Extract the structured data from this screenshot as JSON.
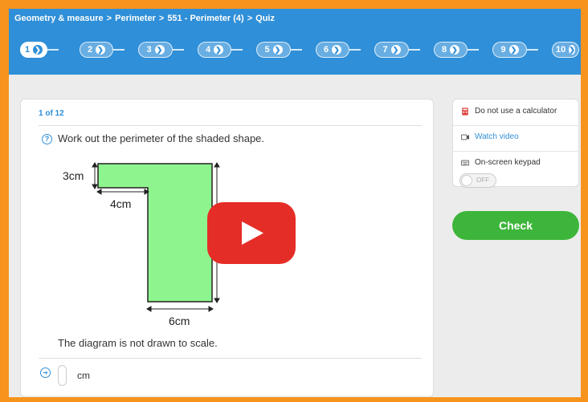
{
  "breadcrumb": [
    "Geometry & measure",
    "Perimeter",
    "551 - Perimeter (4)",
    "Quiz"
  ],
  "breadcrumb_sep": ">",
  "steps": [
    "1",
    "2",
    "3",
    "4",
    "5",
    "6",
    "7",
    "8",
    "9",
    "10"
  ],
  "active_step": "1",
  "question": {
    "counter": "1 of 12",
    "text": "Work out the perimeter of the shaded shape.",
    "labels": {
      "top_height": "3cm",
      "inner_width": "4cm",
      "bottom_width": "6cm"
    },
    "scale_note": "The diagram is not drawn to scale.",
    "answer_unit": "cm",
    "answer_value": ""
  },
  "sidebar": {
    "calculator": "Do not use a calculator",
    "video": "Watch video",
    "keypad": "On-screen keypad",
    "toggle": "OFF"
  },
  "check_label": "Check",
  "colors": {
    "frame": "#f7941d",
    "header": "#2f8fd8",
    "shape_fill": "#8ef58e",
    "check": "#3db53a",
    "play": "#e52d27"
  }
}
